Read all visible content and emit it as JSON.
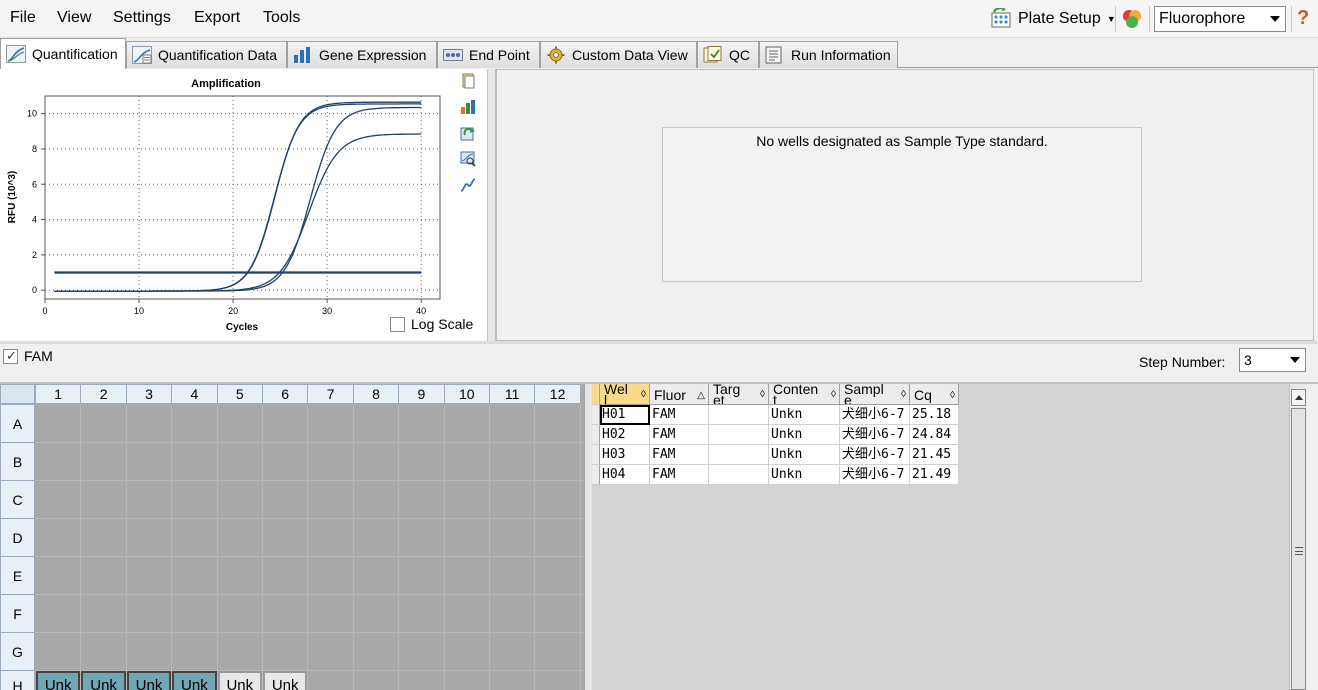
{
  "menu": [
    "File",
    "View",
    "Settings",
    "Export",
    "Tools"
  ],
  "toolbar": {
    "plate_setup": "Plate Setup",
    "view_mode": "Fluorophore",
    "help": "?"
  },
  "tabs": [
    {
      "label": "Quantification",
      "icon": "amplification-curve-icon",
      "active": true
    },
    {
      "label": "Quantification Data",
      "icon": "quant-data-icon"
    },
    {
      "label": "Gene Expression",
      "icon": "bar-chart-icon"
    },
    {
      "label": "End Point",
      "icon": "end-point-icon"
    },
    {
      "label": "Custom Data View",
      "icon": "gear-icon"
    },
    {
      "label": "QC",
      "icon": "qc-icon"
    },
    {
      "label": "Run Information",
      "icon": "run-info-icon"
    }
  ],
  "chart_data": {
    "type": "line",
    "title": "Amplification",
    "xlabel": "Cycles",
    "ylabel": "RFU (10^3)",
    "xlim": [
      0,
      42
    ],
    "ylim": [
      -0.5,
      11
    ],
    "xticks": [
      0,
      10,
      20,
      30,
      40
    ],
    "yticks": [
      0,
      2,
      4,
      6,
      8,
      10
    ],
    "grid": true,
    "threshold": 1.0,
    "series": [
      {
        "well": "H01",
        "cq": 25.18,
        "plateau": 10.4,
        "slope": 1.35
      },
      {
        "well": "H02",
        "cq": 24.84,
        "plateau": 8.9,
        "slope": 1.55
      },
      {
        "well": "H03",
        "cq": 21.45,
        "plateau": 10.6,
        "slope": 1.3
      },
      {
        "well": "H04",
        "cq": 21.49,
        "plateau": 10.7,
        "slope": 1.3
      }
    ]
  },
  "chart_options": {
    "log_scale_label": "Log Scale",
    "log_scale_checked": false
  },
  "chart_tools": [
    "copy-icon",
    "export-icon",
    "refresh-icon",
    "zoom-icon",
    "curve-icon"
  ],
  "standard_message": "No wells designated as Sample Type standard.",
  "fluor_filter": {
    "label": "FAM",
    "checked": true
  },
  "step": {
    "label": "Step Number:",
    "value": "3"
  },
  "plate": {
    "columns": [
      "1",
      "2",
      "3",
      "4",
      "5",
      "6",
      "7",
      "8",
      "9",
      "10",
      "11",
      "12"
    ],
    "rows": [
      "A",
      "B",
      "C",
      "D",
      "E",
      "F",
      "G",
      "H"
    ],
    "visible_row_h": [
      "Unk",
      "Unk",
      "Unk",
      "Unk",
      "Unk",
      "Unk"
    ]
  },
  "table": {
    "headers": [
      "Wel\nl",
      "Fluor",
      "Targ\net",
      "Conten\nt",
      "Sampl\ne",
      "Cq"
    ],
    "rows": [
      [
        "H01",
        "FAM",
        "",
        "Unkn",
        "犬细小6-7",
        "25.18"
      ],
      [
        "H02",
        "FAM",
        "",
        "Unkn",
        "犬细小6-7",
        "24.84"
      ],
      [
        "H03",
        "FAM",
        "",
        "Unkn",
        "犬细小6-7",
        "21.45"
      ],
      [
        "H04",
        "FAM",
        "",
        "Unkn",
        "犬细小6-7",
        "21.49"
      ]
    ]
  },
  "colors": {
    "curve": "#1f3f6e",
    "threshold": "#1f3f6e",
    "unknown_well": "#6fa7b7",
    "grid_bg": "#a9a9a9",
    "header_highlight": "#f9d98a"
  }
}
